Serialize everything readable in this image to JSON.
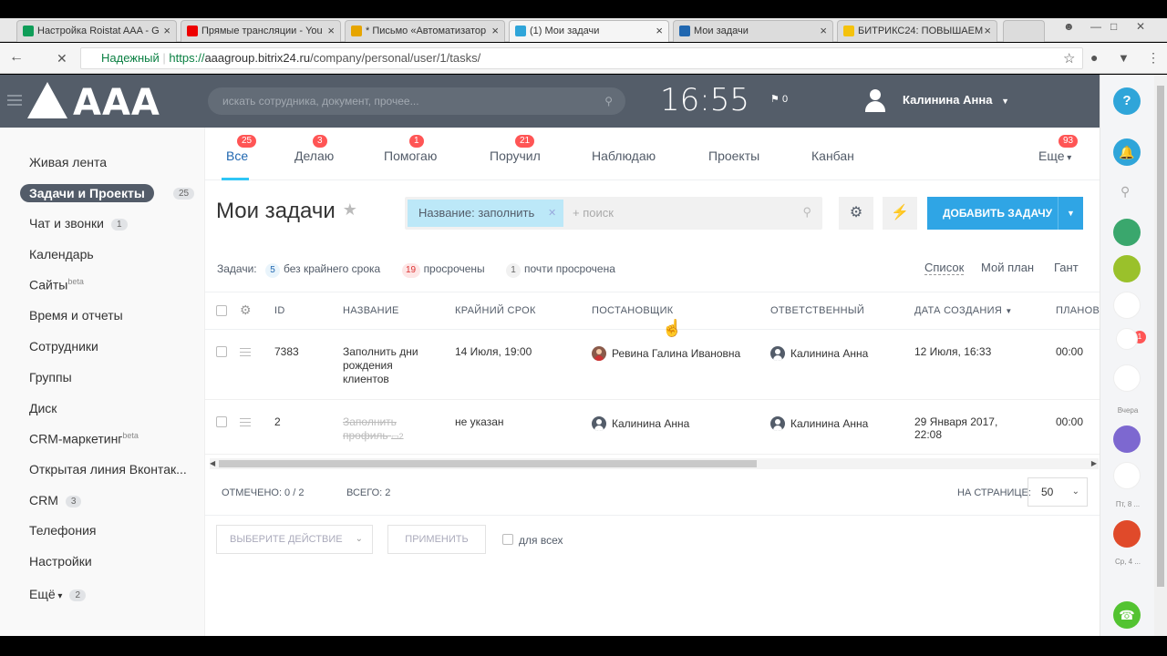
{
  "browser": {
    "tabs": [
      {
        "label": "Настройка Roistat AAA - G",
        "icon_color": "#0f9d58"
      },
      {
        "label": "Прямые трансляции - You",
        "icon_color": "#e00"
      },
      {
        "label": "* Письмо «Автоматизатор",
        "icon_color": "#e6a500"
      },
      {
        "label": "(1) Мои задачи",
        "icon_color": "#2fa5d9"
      },
      {
        "label": "Мои задачи",
        "icon_color": "#2067b0"
      },
      {
        "label": "БИТРИКС24: ПОВЫШАЕМ",
        "icon_color": "#f4c20d"
      }
    ],
    "secure_label": "Надежный",
    "url_scheme": "https://",
    "url_host": "aaagroup.bitrix24.ru",
    "url_path": "/company/personal/user/1/tasks/"
  },
  "header": {
    "logo": "AAA",
    "search_placeholder": "искать сотрудника, документ, прочее...",
    "time": "16:55",
    "flag_count": "0",
    "user_name": "Калинина Анна"
  },
  "left_menu": [
    {
      "label": "Живая лента"
    },
    {
      "label": "Задачи и Проекты",
      "count": "25",
      "active": true
    },
    {
      "label": "Чат и звонки",
      "count": "1"
    },
    {
      "label": "Календарь"
    },
    {
      "label": "Сайты",
      "sup": "beta"
    },
    {
      "label": "Время и отчеты"
    },
    {
      "label": "Сотрудники"
    },
    {
      "label": "Группы"
    },
    {
      "label": "Диск"
    },
    {
      "label": "CRM-маркетинг",
      "sup": "beta"
    },
    {
      "label": "Открытая линия Вконтак..."
    },
    {
      "label": "CRM",
      "count": "3"
    },
    {
      "label": "Телефония"
    },
    {
      "label": "Настройки"
    },
    {
      "label": "Ещё",
      "count": "2"
    }
  ],
  "tabs": [
    {
      "label": "Все",
      "badge": "25"
    },
    {
      "label": "Делаю",
      "badge": "3"
    },
    {
      "label": "Помогаю",
      "badge": "1"
    },
    {
      "label": "Поручил",
      "badge": "21"
    },
    {
      "label": "Наблюдаю"
    },
    {
      "label": "Проекты"
    },
    {
      "label": "Канбан"
    },
    {
      "label": "Еще",
      "badge": "93"
    }
  ],
  "page_title": "Мои задачи",
  "filter": {
    "chip": "Название: заполнить",
    "search_placeholder": "+ поиск"
  },
  "add_task_label": "ДОБАВИТЬ ЗАДАЧУ",
  "counters": {
    "prefix": "Задачи:",
    "no_deadline_count": "5",
    "no_deadline_label": "без крайнего срока",
    "overdue_count": "19",
    "overdue_label": "просрочены",
    "almost_count": "1",
    "almost_label": "почти просрочена"
  },
  "views": [
    "Список",
    "Мой план",
    "Гант"
  ],
  "columns": [
    "ID",
    "НАЗВАНИЕ",
    "КРАЙНИЙ СРОК",
    "ПОСТАНОВЩИК",
    "ОТВЕТСТВЕННЫЙ",
    "ДАТА СОЗДАНИЯ",
    "ПЛАНОВ"
  ],
  "rows": [
    {
      "id": "7383",
      "title": "Заполнить дни рождения клиентов",
      "deadline": "14 Июля, 19:00",
      "creator": "Ревина Галина Ивановна",
      "responsible": "Калинина Анна",
      "created": "12 Июля, 16:33",
      "planned": "00:00",
      "completed": false
    },
    {
      "id": "2",
      "title": "Заполнить профиль",
      "comments": "2",
      "deadline": "не указан",
      "creator": "Калинина Анна",
      "responsible": "Калинина Анна",
      "created": "29 Января 2017, 22:08",
      "planned": "00:00",
      "completed": true
    }
  ],
  "footer": {
    "selected": "ОТМЕЧЕНО: 0 / 2",
    "total": "ВСЕГО: 2",
    "per_page_label": "НА СТРАНИЦЕ:",
    "per_page_value": "50"
  },
  "actions": {
    "select_placeholder": "ВЫБЕРИТЕ ДЕЙСТВИЕ",
    "apply": "ПРИМЕНИТЬ",
    "for_all": "для всех"
  },
  "right_bar": {
    "help": "?",
    "notif_badge": "1",
    "label_yesterday": "Вчера",
    "label_fri": "Пт, 8 ...",
    "label_wed": "Ср, 4 ...",
    "dot_colors": [
      "#3aa76d",
      "#9ac12b",
      "#7d68d0",
      "#e04a2a"
    ]
  }
}
